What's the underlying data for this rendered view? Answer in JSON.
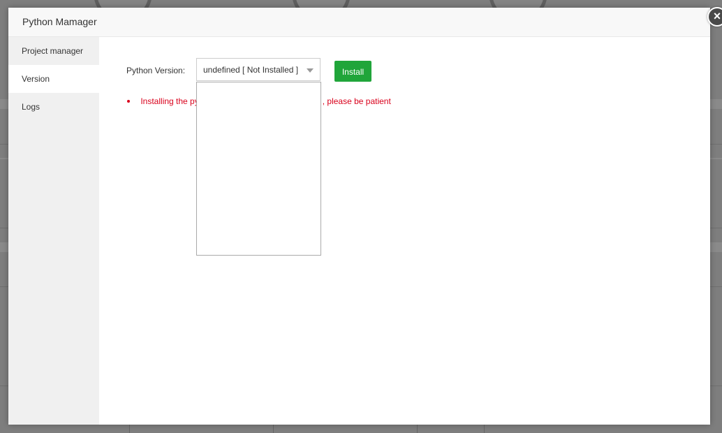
{
  "dialog": {
    "title": "Python Mamager",
    "close_label": "×"
  },
  "sidebar": {
    "items": [
      {
        "label": "Project manager"
      },
      {
        "label": "Version",
        "active": true
      },
      {
        "label": "Logs"
      }
    ]
  },
  "version_form": {
    "label": "Python Version:",
    "selected_value": "undefined  [ Not Installed ]",
    "options": [],
    "install_label": "Install",
    "notice_prefix": "Installing the py",
    "notice_suffix": ", please be patient"
  },
  "colors": {
    "accent": "#20a53a",
    "notice": "#d9001b",
    "sidebar_bg": "#f0f0f0"
  },
  "icons": {
    "close": "close-icon",
    "caret": "chevron-down-icon"
  }
}
